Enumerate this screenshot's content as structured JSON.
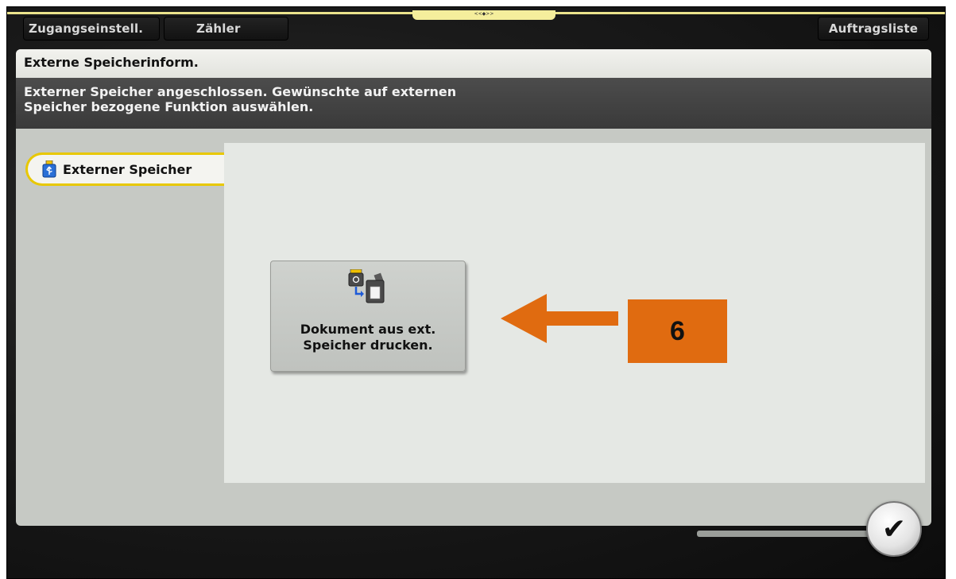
{
  "top_tabs": {
    "access_settings": "Zugangseinstell.",
    "counter": "Zähler",
    "job_list": "Auftragsliste",
    "center_handle": "<<◆>>"
  },
  "panel": {
    "title": "Externe Speicherinform.",
    "message": "Externer Speicher angeschlossen. Gewünschte auf externen\nSpeicher bezogene Funktion auswählen."
  },
  "side_tab": {
    "label": "Externer Speicher",
    "icon": "usb-memory-icon"
  },
  "print_button": {
    "label": "Dokument aus ext.\nSpeicher drucken.",
    "icon": "print-from-usb-icon"
  },
  "ok_button": {
    "symbol": "✔"
  },
  "annotation": {
    "step_number": "6",
    "arrow_color": "#e06b10",
    "box_color": "#e06b10"
  },
  "colors": {
    "selected_outline": "#e8c800",
    "header_bar": "#3f3f3f",
    "top_line": "#ebe38c"
  }
}
